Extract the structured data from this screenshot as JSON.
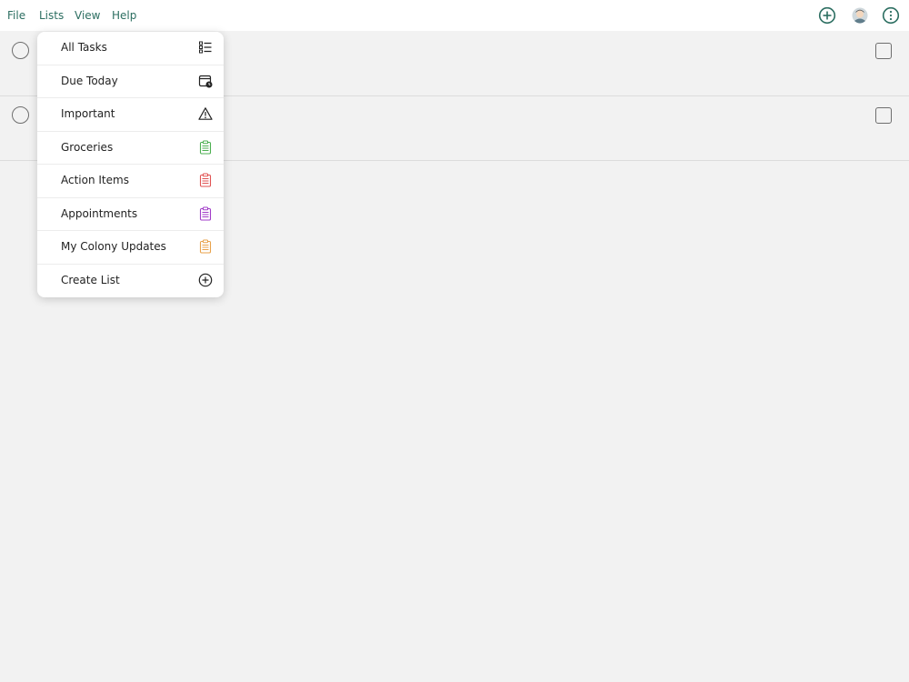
{
  "menubar": {
    "items": [
      {
        "label": "File"
      },
      {
        "label": "Lists"
      },
      {
        "label": "View"
      },
      {
        "label": "Help"
      }
    ],
    "actions": [
      {
        "icon": "add-circle-icon"
      },
      {
        "icon": "avatar-icon"
      },
      {
        "icon": "info-icon"
      }
    ]
  },
  "lists_menu": {
    "items": [
      {
        "label": "All Tasks",
        "icon": "list-icon",
        "color": "#222222"
      },
      {
        "label": "Due Today",
        "icon": "calendar-clock-icon",
        "color": "#222222"
      },
      {
        "label": "Important",
        "icon": "warning-icon",
        "color": "#222222"
      },
      {
        "label": "Groceries",
        "icon": "clipboard-icon",
        "color": "#4caf50"
      },
      {
        "label": "Action Items",
        "icon": "clipboard-icon",
        "color": "#e05252"
      },
      {
        "label": "Appointments",
        "icon": "clipboard-icon",
        "color": "#a13cc8"
      },
      {
        "label": "My Colony Updates",
        "icon": "clipboard-icon",
        "color": "#e8a24a"
      },
      {
        "label": "Create List",
        "icon": "add-circle-icon",
        "color": "#222222"
      }
    ]
  },
  "accent_color": "#2c6e61"
}
